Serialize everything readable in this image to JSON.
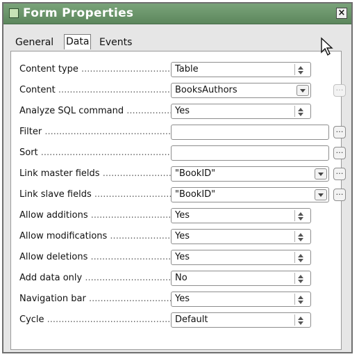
{
  "window": {
    "title": "Form Properties",
    "close_label": "×"
  },
  "tabs": [
    {
      "label": "General"
    },
    {
      "label": "Data",
      "selected": true
    },
    {
      "label": "Events"
    }
  ],
  "properties": [
    {
      "label": "Content type",
      "value": "Table",
      "control": "spin"
    },
    {
      "label": "Content",
      "value": "BooksAuthors",
      "control": "dropdown",
      "dots": "…",
      "dots_disabled": true
    },
    {
      "label": "Analyze SQL command",
      "value": "Yes",
      "control": "spin"
    },
    {
      "label": "Filter",
      "value": "",
      "control": "text",
      "dots": "…"
    },
    {
      "label": "Sort",
      "value": "",
      "control": "text",
      "dots": "…"
    },
    {
      "label": "Link master fields",
      "value": "\"BookID\"",
      "control": "dropdown",
      "dots": "…"
    },
    {
      "label": "Link slave fields",
      "value": "\"BookID\"",
      "control": "dropdown",
      "dots": "…"
    },
    {
      "label": "Allow additions",
      "value": "Yes",
      "control": "spin"
    },
    {
      "label": "Allow modifications",
      "value": "Yes",
      "control": "spin"
    },
    {
      "label": "Allow deletions",
      "value": "Yes",
      "control": "spin"
    },
    {
      "label": "Add data only",
      "value": "No",
      "control": "spin"
    },
    {
      "label": "Navigation bar",
      "value": "Yes",
      "control": "spin"
    },
    {
      "label": "Cycle",
      "value": "Default",
      "control": "spin"
    }
  ],
  "colors": {
    "titlebar": "#6b936c",
    "window_bg": "#e6e6e6",
    "panel_bg": "#ffffff"
  },
  "icons": {
    "app": "form-icon",
    "close": "close-icon",
    "cursor": "mouse-pointer-icon"
  }
}
